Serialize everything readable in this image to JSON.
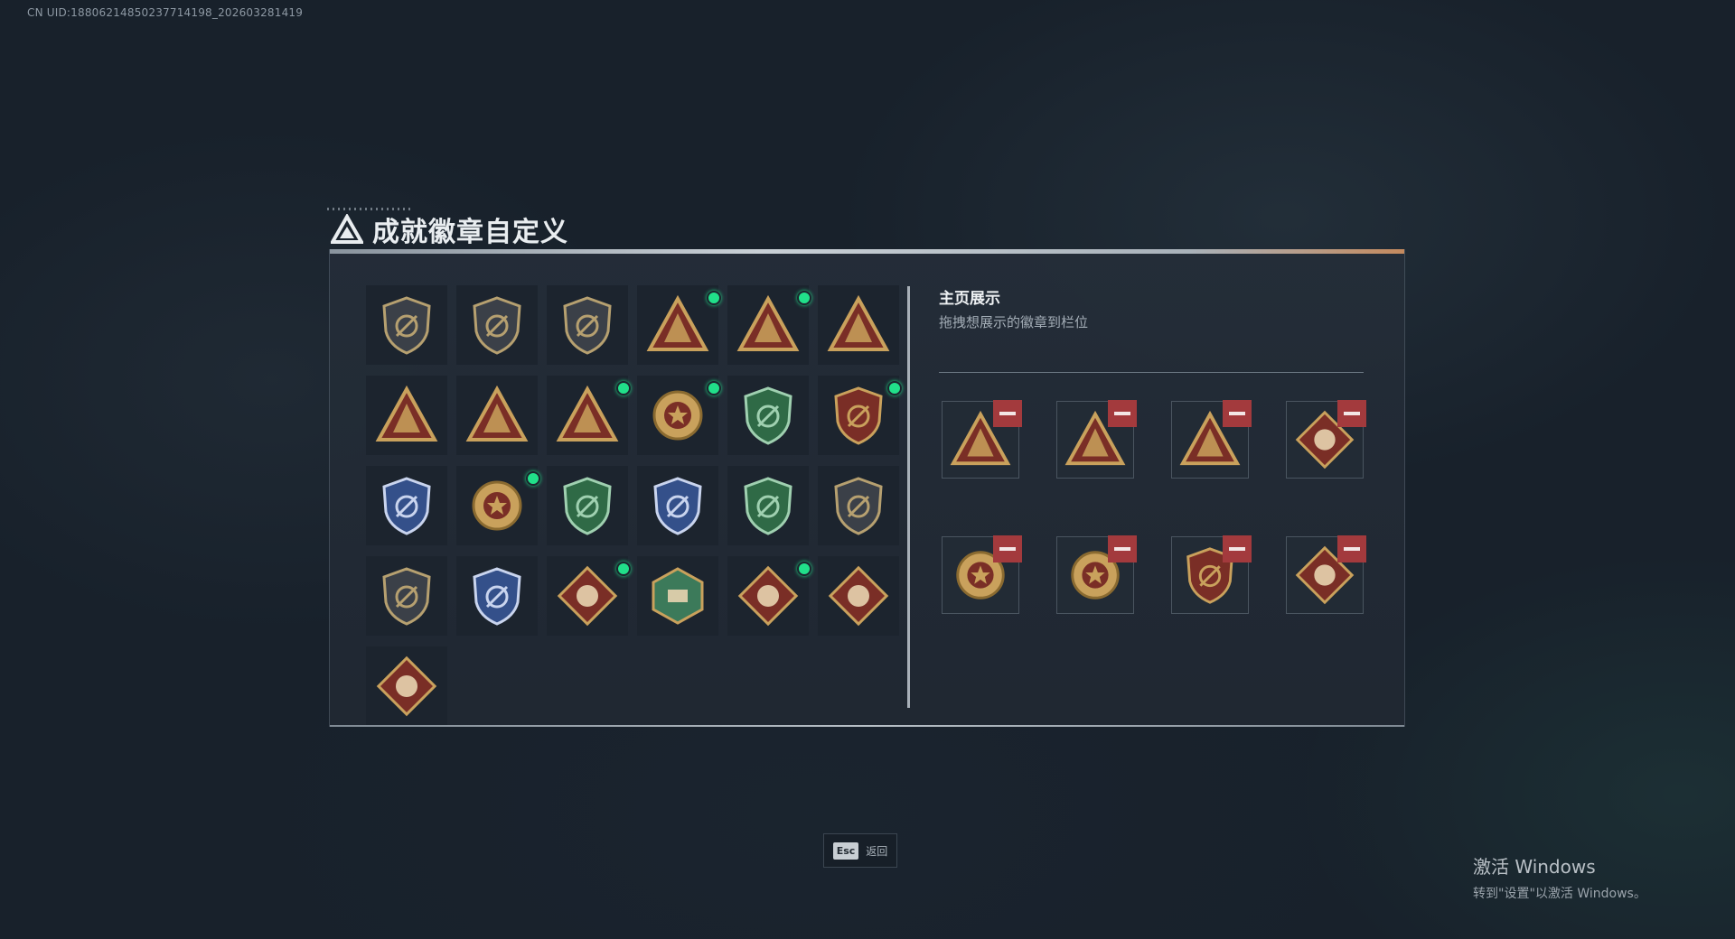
{
  "uid_text": "CN UID:188062148502377141​98_202603281419",
  "title": "成就徽章自定义",
  "title_icon": "triangle-logo-icon",
  "badges": [
    {
      "icon": "shield-triangle-badge",
      "new": false
    },
    {
      "icon": "shield-helicopter-badge",
      "new": false
    },
    {
      "icon": "shield-jet-badge",
      "new": false
    },
    {
      "icon": "triangle-trophy-badge",
      "new": true
    },
    {
      "icon": "triangle-moneybag-badge",
      "new": true
    },
    {
      "icon": "triangle-hands-badge",
      "new": false
    },
    {
      "icon": "triangle-number-one-badge",
      "new": false
    },
    {
      "icon": "triangle-crate-badge",
      "new": false
    },
    {
      "icon": "triangle-squad-badge",
      "new": true
    },
    {
      "icon": "round-star-medal-badge",
      "new": true
    },
    {
      "icon": "green-shield-medal-badge",
      "new": false
    },
    {
      "icon": "red-shield-stars-badge",
      "new": true
    },
    {
      "icon": "blue-shield-emblem-badge",
      "new": false
    },
    {
      "icon": "gold-round-emblem-badge",
      "new": true
    },
    {
      "icon": "green-tank-badge",
      "new": false
    },
    {
      "icon": "blue-crosshair-badge",
      "new": false
    },
    {
      "icon": "green-rifle-badge",
      "new": false
    },
    {
      "icon": "dark-shield-rifle-badge",
      "new": false
    },
    {
      "icon": "dark-shield-sniper-badge",
      "new": false
    },
    {
      "icon": "blue-crosshair-rifle-badge",
      "new": false
    },
    {
      "icon": "diamond-beast-badge",
      "new": true
    },
    {
      "icon": "hexagon-weapons-badge",
      "new": false
    },
    {
      "icon": "diamond-dragon-badge",
      "new": true
    },
    {
      "icon": "diamond-runner-badge",
      "new": false
    },
    {
      "icon": "diamond-fist-badge",
      "new": false
    }
  ],
  "showcase": {
    "title": "主页展示",
    "subtitle": "拖拽想展示的徽章到栏位",
    "slots": [
      {
        "icon": "triangle-trophy-badge"
      },
      {
        "icon": "triangle-moneybag-badge"
      },
      {
        "icon": "triangle-squad-badge"
      },
      {
        "icon": "diamond-beast-badge"
      },
      {
        "icon": "gold-round-emblem-badge"
      },
      {
        "icon": "round-star-medal-badge"
      },
      {
        "icon": "red-shield-stars-badge"
      },
      {
        "icon": "diamond-dragon-badge"
      }
    ],
    "remove_icon": "minus-icon"
  },
  "esc": {
    "key": "Esc",
    "label": "返回"
  },
  "windows": {
    "title": "激活 Windows",
    "subtitle": "转到\"设置\"以激活 Windows。"
  },
  "colors": {
    "gold": "#c9a15c",
    "dark_red": "#7a2e26",
    "new_dot": "#21e08a",
    "remove": "#a33a3d"
  }
}
